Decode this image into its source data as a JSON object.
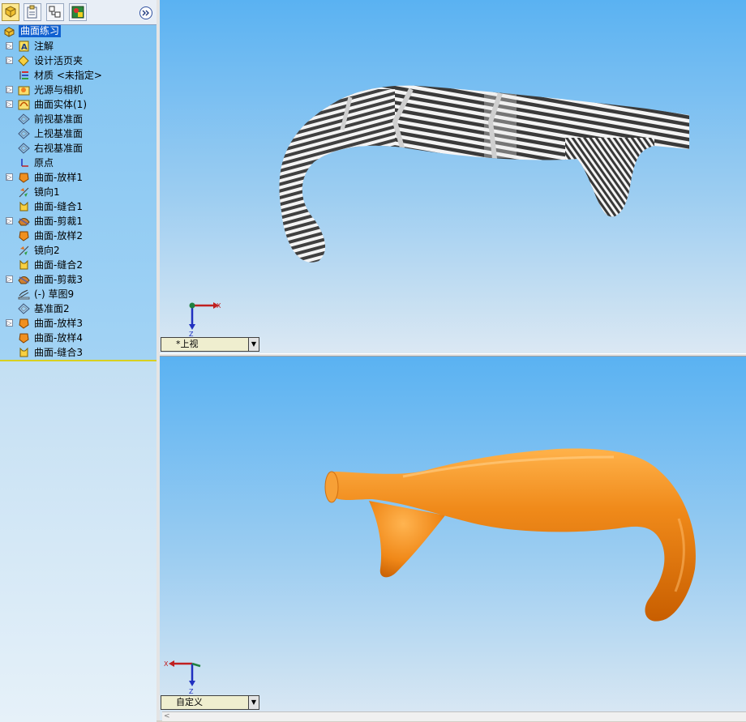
{
  "tree": {
    "root": "曲面练习",
    "items": [
      {
        "label": "注解",
        "icon": "annotation-icon",
        "expandable": true
      },
      {
        "label": "设计活页夹",
        "icon": "design-binder-icon",
        "expandable": true
      },
      {
        "label": "材质 <未指定>",
        "icon": "material-icon",
        "expandable": false
      },
      {
        "label": "光源与相机",
        "icon": "lights-camera-icon",
        "expandable": true
      },
      {
        "label": "曲面实体(1)",
        "icon": "surface-bodies-icon",
        "expandable": true
      },
      {
        "label": "前视基准面",
        "icon": "plane-icon",
        "expandable": false
      },
      {
        "label": "上视基准面",
        "icon": "plane-icon",
        "expandable": false
      },
      {
        "label": "右视基准面",
        "icon": "plane-icon",
        "expandable": false
      },
      {
        "label": "原点",
        "icon": "origin-icon",
        "expandable": false
      },
      {
        "label": "曲面-放样1",
        "icon": "surface-loft-icon",
        "expandable": true
      },
      {
        "label": "镜向1",
        "icon": "mirror-icon",
        "expandable": false
      },
      {
        "label": "曲面-缝合1",
        "icon": "surface-knit-icon",
        "expandable": false
      },
      {
        "label": "曲面-剪裁1",
        "icon": "surface-trim-icon",
        "expandable": true
      },
      {
        "label": "曲面-放样2",
        "icon": "surface-loft-icon",
        "expandable": false
      },
      {
        "label": "镜向2",
        "icon": "mirror-icon",
        "expandable": false
      },
      {
        "label": "曲面-缝合2",
        "icon": "surface-knit-icon",
        "expandable": false
      },
      {
        "label": "曲面-剪裁3",
        "icon": "surface-trim-icon",
        "expandable": true
      },
      {
        "label": "(-) 草图9",
        "icon": "sketch-icon",
        "expandable": false
      },
      {
        "label": "基准面2",
        "icon": "plane-icon",
        "expandable": false
      },
      {
        "label": "曲面-放样3",
        "icon": "surface-loft-icon",
        "expandable": true
      },
      {
        "label": "曲面-放样4",
        "icon": "surface-loft-icon",
        "expandable": false
      },
      {
        "label": "曲面-缝合3",
        "icon": "surface-knit-icon",
        "expandable": false
      }
    ]
  },
  "viewport_top": {
    "view_name": "*上视",
    "triad": {
      "x": "X",
      "z": "Z"
    }
  },
  "viewport_bottom": {
    "view_name": "自定义",
    "triad": {
      "x": "X",
      "z": "Z"
    }
  },
  "colors": {
    "background_top": "#5ab2f2",
    "background_bottom": "#dbe8f3",
    "model_orange": "#f08a1a",
    "zebra_dark": "#404040",
    "zebra_light": "#f4f4f4"
  }
}
